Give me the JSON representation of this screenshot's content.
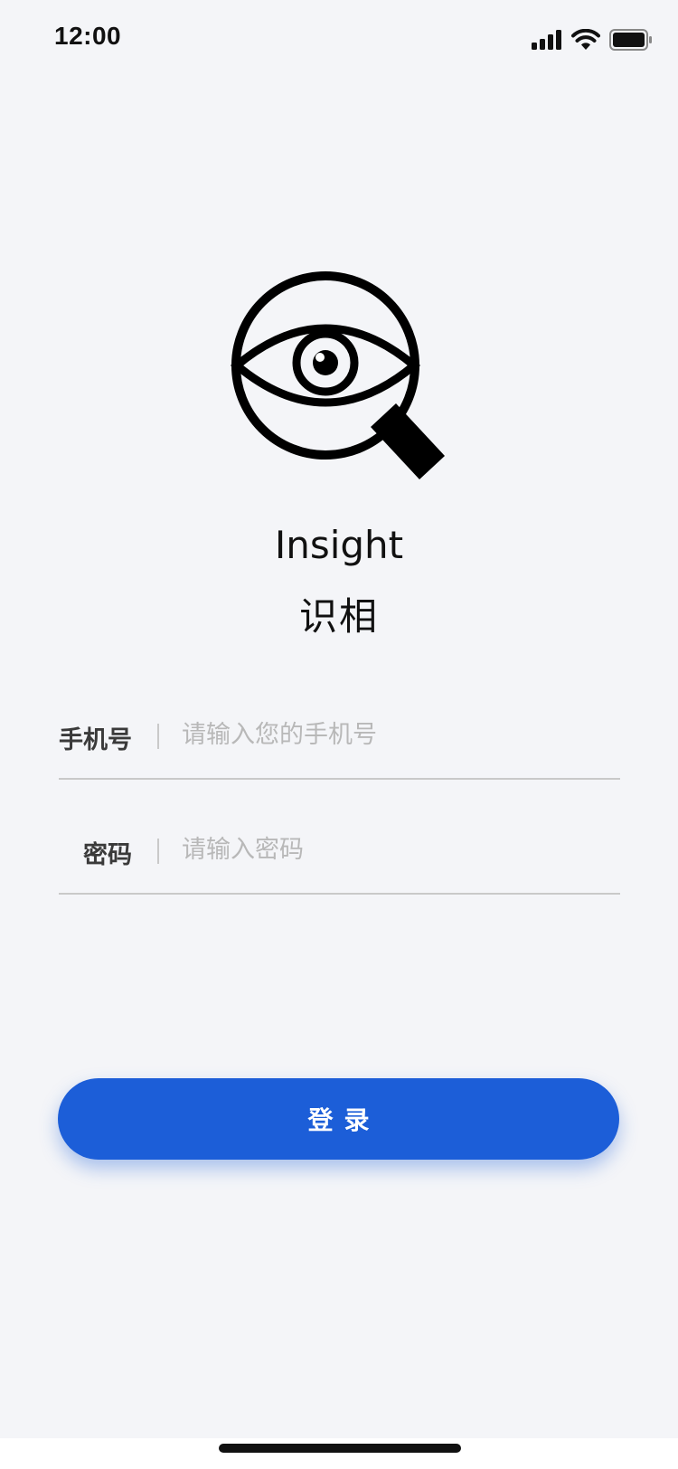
{
  "status_bar": {
    "time": "12:00",
    "icons": [
      "cellular-signal-icon",
      "wifi-icon",
      "battery-icon"
    ]
  },
  "app": {
    "logo_icon": "magnifier-eye-icon",
    "name": "Insight",
    "name_cn": "识相"
  },
  "form": {
    "phone": {
      "label": "手机号",
      "placeholder": "请输入您的手机号",
      "value": ""
    },
    "password": {
      "label": "密码",
      "placeholder": "请输入密码",
      "value": ""
    }
  },
  "login_button": {
    "label": "登录"
  },
  "colors": {
    "background": "#f4f5f8",
    "accent": "#1c5ed8",
    "text": "#111111",
    "placeholder": "#b8b8b8"
  }
}
